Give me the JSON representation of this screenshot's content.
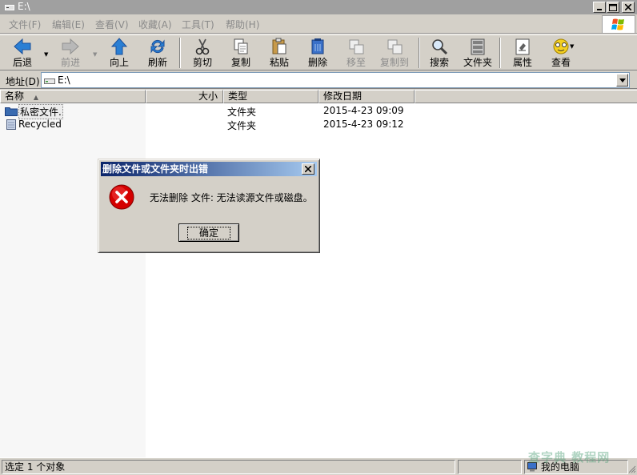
{
  "window": {
    "title": "E:\\"
  },
  "menu": [
    "文件(F)",
    "编辑(E)",
    "查看(V)",
    "收藏(A)",
    "工具(T)",
    "帮助(H)"
  ],
  "toolbar": {
    "back": "后退",
    "forward": "前进",
    "up": "向上",
    "refresh": "刷新",
    "cut": "剪切",
    "copy": "复制",
    "paste": "粘贴",
    "delete": "删除",
    "move_to": "移至",
    "copy_to": "复制到",
    "search": "搜索",
    "folders": "文件夹",
    "properties": "属性",
    "views": "查看"
  },
  "address": {
    "label": "地址(D)",
    "value": "E:\\"
  },
  "columns": {
    "name": "名称",
    "size": "大小",
    "type": "类型",
    "modified": "修改日期"
  },
  "files": [
    {
      "name": "私密文件.",
      "size": "",
      "type": "文件夹",
      "modified": "2015-4-23 09:09"
    },
    {
      "name": "Recycled",
      "size": "",
      "type": "文件夹",
      "modified": "2015-4-23 09:12"
    }
  ],
  "status": {
    "text": "选定 1 个对象",
    "zone": "我的电脑"
  },
  "dialog": {
    "title": "删除文件或文件夹时出错",
    "message": "无法删除 文件: 无法读源文件或磁盘。",
    "ok_label": "确定"
  },
  "watermark": "查字典 教程网",
  "colors": {
    "dialog_title_start": "#0a246a",
    "dialog_title_end": "#a6caf0",
    "error_red": "#d40000"
  }
}
